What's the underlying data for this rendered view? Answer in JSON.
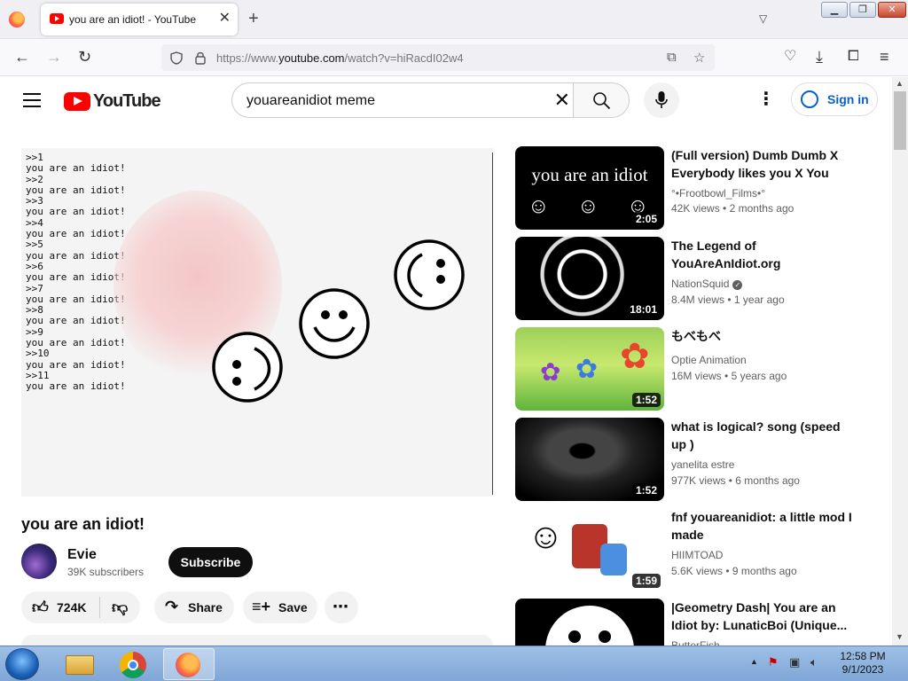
{
  "browser": {
    "tab_title": "you are an idiot! - YouTube",
    "new_tab_symbol": "+",
    "url_prefix": "https://www.",
    "url_domain": "youtube.com",
    "url_path": "/watch?v=hiRacdI02w4",
    "window_controls": [
      "minimize-icon",
      "restore-icon",
      "close-icon"
    ]
  },
  "youtube": {
    "logo_text": "YouTube",
    "search_query": "youareanidiot meme",
    "signin_label": "Sign in"
  },
  "player": {
    "terminal_lines": [
      ">>1",
      "you are an idiot!",
      ">>2",
      "you are an idiot!",
      ">>3",
      "you are an idiot!",
      ">>4",
      "you are an idiot!",
      ">>5",
      "you are an idiot!",
      ">>6",
      "you are an idiot!",
      ">>7",
      "you are an idiot!",
      ">>8",
      "you are an idiot!",
      ">>9",
      "you are an idiot!",
      ">>10",
      "you are an idiot!",
      ">>11",
      "you are an idiot!"
    ]
  },
  "video": {
    "title": "you are an idiot!",
    "channel_name": "Evie",
    "subscribers": "39K subscribers",
    "subscribe_label": "Subscribe",
    "likes": "724K",
    "share_label": "Share",
    "save_label": "Save"
  },
  "recommendations": [
    {
      "title": "(Full version) Dumb Dumb X Everybody likes you X You are...",
      "channel": "°•Frootbowl_Films•°",
      "verified": false,
      "views": "42K views",
      "age": "2 months ago",
      "duration": "2:05",
      "thumb_text": "you are an idiot"
    },
    {
      "title": "The Legend of YouAreAnIdiot.org",
      "channel": "NationSquid",
      "verified": true,
      "views": "8.4M views",
      "age": "1 year ago",
      "duration": "18:01"
    },
    {
      "title": "もべもべ",
      "channel": "Optie Animation",
      "verified": false,
      "views": "16M views",
      "age": "5 years ago",
      "duration": "1:52"
    },
    {
      "title": "what is logical? song (speed up )",
      "channel": "yanelita estre",
      "verified": false,
      "views": "977K views",
      "age": "6 months ago",
      "duration": "1:52"
    },
    {
      "title": "fnf youareanidiot: a little mod I made",
      "channel": "HIIMTOAD",
      "verified": false,
      "views": "5.6K views",
      "age": "9 months ago",
      "duration": "1:59"
    },
    {
      "title": "|Geometry Dash| You are an Idiot by: LunaticBoi (Unique...",
      "channel": "ButterFish",
      "verified": false,
      "views": "",
      "age": "",
      "duration": ""
    }
  ],
  "taskbar": {
    "time": "12:58 PM",
    "date": "9/1/2023"
  }
}
